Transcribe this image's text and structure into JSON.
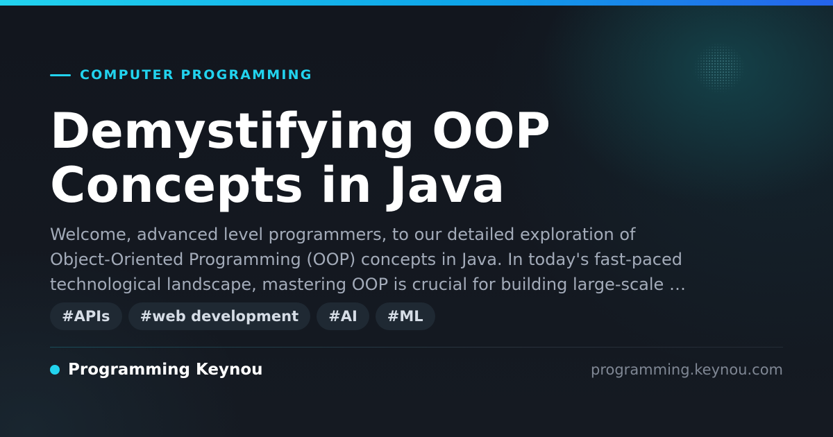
{
  "category": "COMPUTER PROGRAMMING",
  "title": "Demystifying OOP\nConcepts in Java",
  "title_lines": [
    "Demystifying OOP",
    "Concepts in Java"
  ],
  "description_lines": [
    "Welcome, advanced level programmers, to our detailed exploration of",
    "Object-Oriented Programming (OOP) concepts in Java. In today's fast-paced",
    "technological landscape, mastering OOP is crucial for building large-scale …"
  ],
  "tags": [
    "#APIs",
    "#web development",
    "#AI",
    "#ML"
  ],
  "brand": {
    "name": "Programming Keynou",
    "domain": "programming.keynou.com"
  },
  "colors": {
    "accent": "#22d3ee",
    "background": "#13171f",
    "title": "#ffffff",
    "description": "#a3abb9",
    "tag_background": "#1f2933",
    "domain": "#7f8794"
  }
}
